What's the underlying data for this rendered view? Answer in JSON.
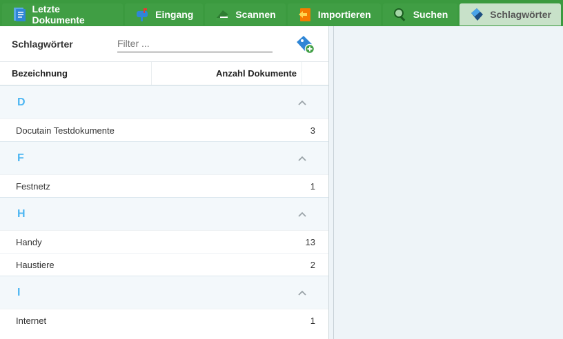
{
  "tabs": [
    {
      "label": "Letzte Dokumente",
      "icon": "document-icon"
    },
    {
      "label": "Eingang",
      "icon": "mailbox-icon"
    },
    {
      "label": "Scannen",
      "icon": "scanner-icon"
    },
    {
      "label": "Importieren",
      "icon": "import-icon"
    },
    {
      "label": "Suchen",
      "icon": "search-icon"
    },
    {
      "label": "Schlagwörter",
      "icon": "tag-icon",
      "active": true
    }
  ],
  "panel": {
    "title": "Schlagwörter",
    "filter_placeholder": "Filter ...",
    "filter_value": ""
  },
  "columns": {
    "name": "Bezeichnung",
    "count": "Anzahl Dokumente"
  },
  "groups": [
    {
      "letter": "D",
      "items": [
        {
          "name": "Docutain Testdokumente",
          "count": "3"
        }
      ]
    },
    {
      "letter": "F",
      "items": [
        {
          "name": "Festnetz",
          "count": "1"
        }
      ]
    },
    {
      "letter": "H",
      "items": [
        {
          "name": "Handy",
          "count": "13"
        },
        {
          "name": "Haustiere",
          "count": "2"
        }
      ]
    },
    {
      "letter": "I",
      "items": [
        {
          "name": "Internet",
          "count": "1"
        }
      ]
    }
  ],
  "colors": {
    "tabbar": "#3b9a3f",
    "active_tab": "#c8e1c9",
    "group_letter": "#4db6f2",
    "background": "#eef4f8"
  }
}
